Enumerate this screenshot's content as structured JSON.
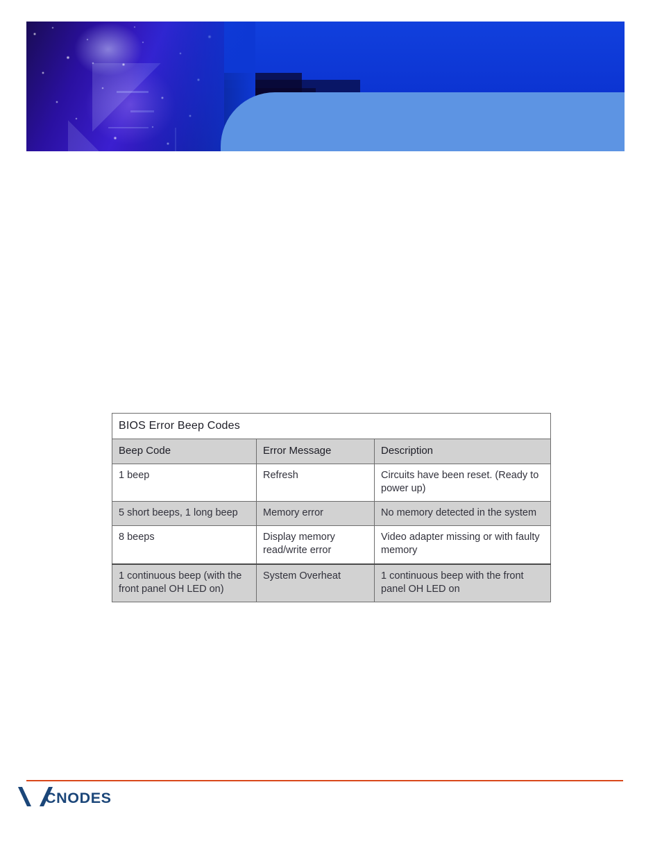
{
  "banner": {
    "image_alt": "circuit-board-photo",
    "dark_blue": "#0d38d4",
    "light_blue": "#5d94e3"
  },
  "table": {
    "title": "BIOS Error Beep Codes",
    "columns": [
      "Beep Code",
      "Error Message",
      "Description"
    ],
    "rows": [
      {
        "beep_code": "1 beep",
        "error_message": "Refresh",
        "description": "Circuits have been reset. (Ready to power up)"
      },
      {
        "beep_code": "5 short beeps, 1 long beep",
        "error_message": "Memory error",
        "description": "No memory detected in the system"
      },
      {
        "beep_code": "8 beeps",
        "error_message": "Display memory read/write error",
        "description": "Video adapter missing or with faulty memory"
      },
      {
        "beep_code": "1 continuous beep (with the front panel OH LED on)",
        "error_message": "System Overheat",
        "description": "1 continuous beep with the front panel OH LED on"
      }
    ]
  },
  "footer": {
    "logo_text": "CNODES",
    "rule_color": "#d9481a",
    "logo_color": "#1b4679"
  }
}
